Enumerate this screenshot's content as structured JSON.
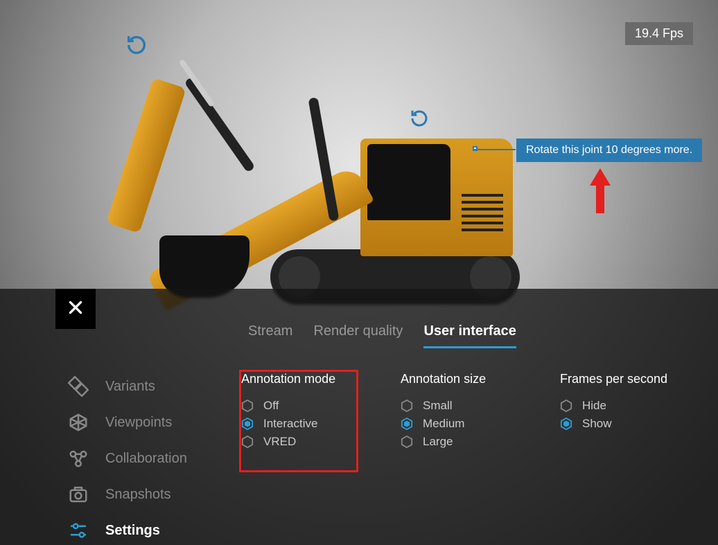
{
  "fps_label": "19.4 Fps",
  "annotation_tooltip": "Rotate this joint 10 degrees more.",
  "tabs": [
    {
      "label": "Stream",
      "active": false
    },
    {
      "label": "Render quality",
      "active": false
    },
    {
      "label": "User interface",
      "active": true
    }
  ],
  "sidebar": [
    {
      "label": "Variants",
      "icon": "variants",
      "active": false
    },
    {
      "label": "Viewpoints",
      "icon": "viewpoints",
      "active": false
    },
    {
      "label": "Collaboration",
      "icon": "collaboration",
      "active": false
    },
    {
      "label": "Snapshots",
      "icon": "snapshots",
      "active": false
    },
    {
      "label": "Settings",
      "icon": "settings",
      "active": true
    }
  ],
  "settings": {
    "annotation_mode": {
      "title": "Annotation mode",
      "options": [
        "Off",
        "Interactive",
        "VRED"
      ],
      "selected": "Interactive"
    },
    "annotation_size": {
      "title": "Annotation size",
      "options": [
        "Small",
        "Medium",
        "Large"
      ],
      "selected": "Medium"
    },
    "fps": {
      "title": "Frames per second",
      "options": [
        "Hide",
        "Show"
      ],
      "selected": "Show"
    }
  },
  "colors": {
    "accent": "#2a9fd6",
    "callout": "#2a7ab0",
    "highlight": "#e2201d"
  }
}
